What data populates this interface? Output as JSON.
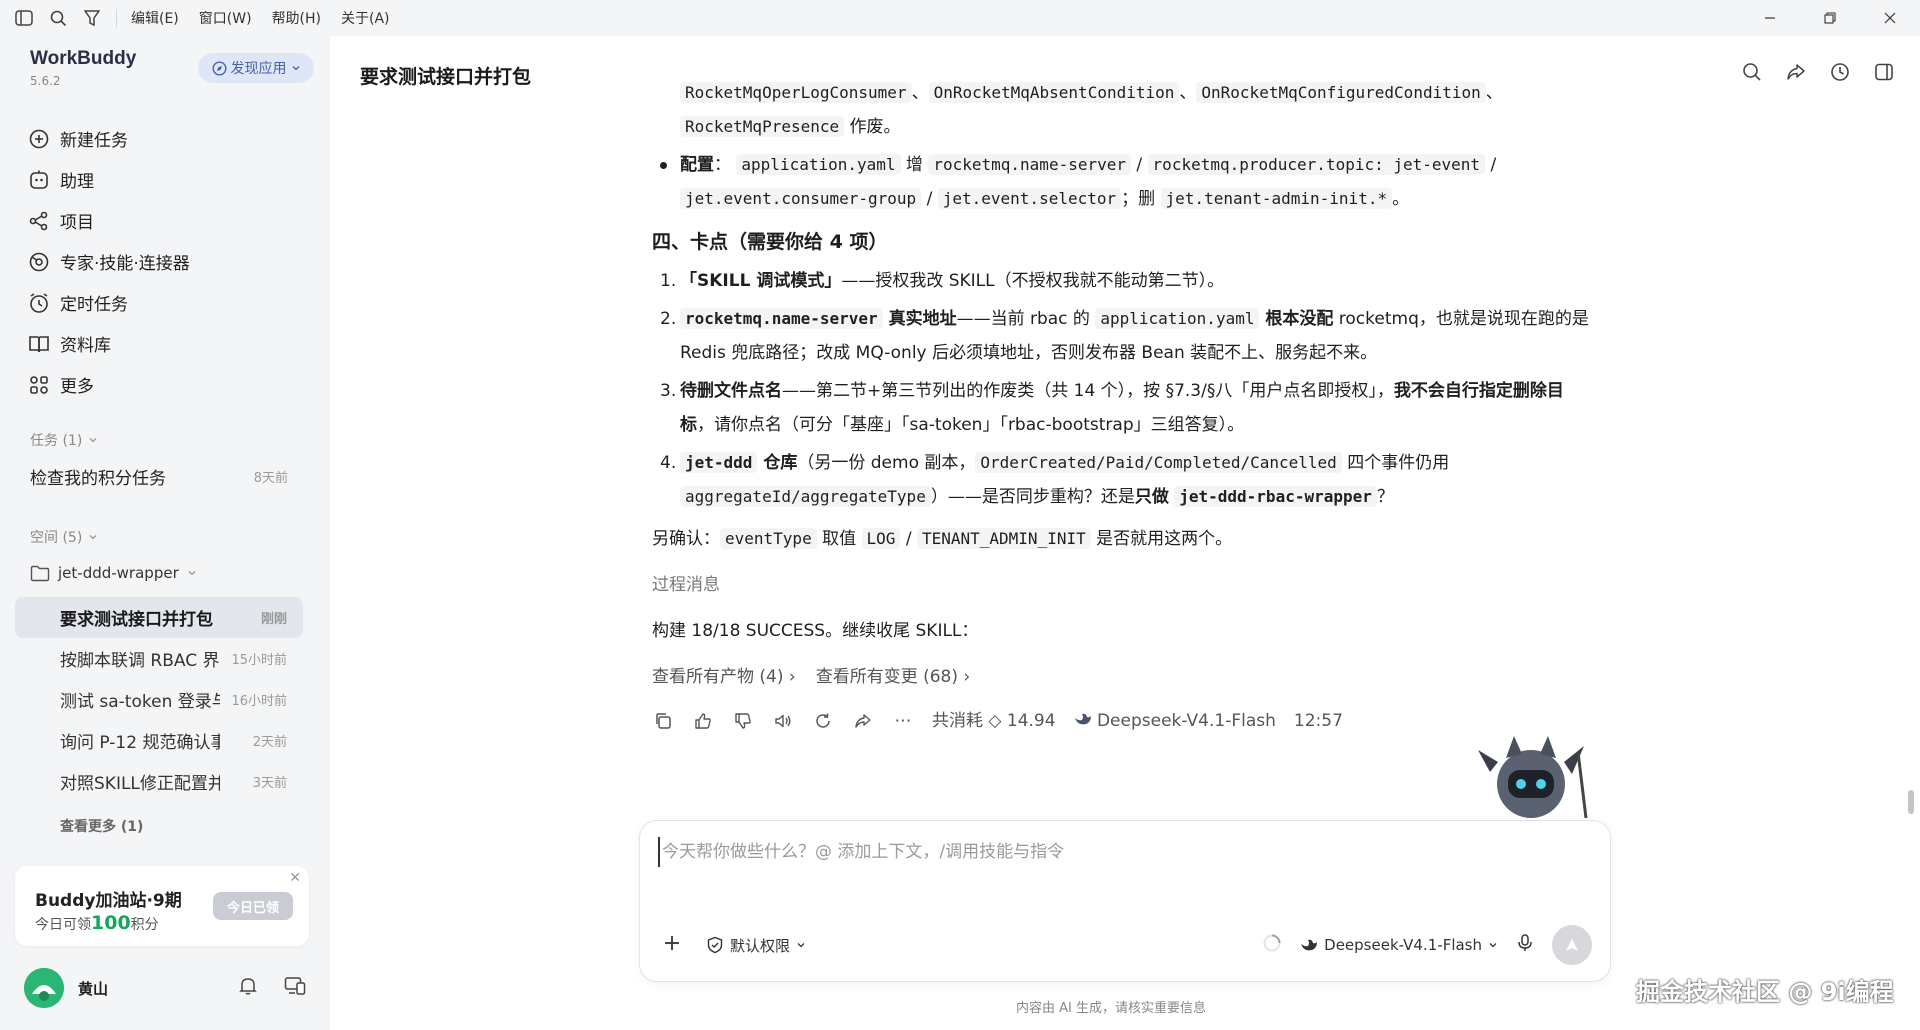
{
  "menubar": {
    "menus": [
      "编辑(E)",
      "窗口(W)",
      "帮助(H)",
      "关于(A)"
    ]
  },
  "app": {
    "name": "WorkBuddy",
    "version": "5.6.2",
    "discover_label": "发现应用"
  },
  "nav": [
    {
      "label": "新建任务",
      "icon": "plus-circle-icon"
    },
    {
      "label": "助理",
      "icon": "assistant-icon"
    },
    {
      "label": "项目",
      "icon": "project-icon"
    },
    {
      "label": "专家·技能·连接器",
      "icon": "expert-icon"
    },
    {
      "label": "定时任务",
      "icon": "clock-icon"
    },
    {
      "label": "资料库",
      "icon": "book-icon"
    },
    {
      "label": "更多",
      "icon": "grid-icon"
    }
  ],
  "tasks": {
    "header": "任务 (1)",
    "items": [
      {
        "title": "检查我的积分任务",
        "time": "8天前"
      }
    ]
  },
  "spaces": {
    "header": "空间 (5)",
    "folder": "jet-ddd-wrapper",
    "conversations": [
      {
        "title": "要求测试接口并打包",
        "time": "刚刚"
      },
      {
        "title": "按脚本联调 RBAC 界",
        "time": "15小时前"
      },
      {
        "title": "测试 sa-token 登录与",
        "time": "16小时前"
      },
      {
        "title": "询问 P-12 规范确认事项",
        "time": "2天前"
      },
      {
        "title": "对照SKILL修正配置并出",
        "time": "3天前"
      }
    ],
    "see_more": "查看更多 (1)"
  },
  "promo": {
    "title": "Buddy加油站·9期",
    "sub_prefix": "今日可领",
    "points": "100",
    "sub_suffix": "积分",
    "button": "今日已领"
  },
  "user": {
    "name": "黄山"
  },
  "main": {
    "title": "要求测试接口并打包",
    "top_line": {
      "codes": [
        "RocketMqOperLogConsumer",
        "OnRocketMqAbsentCondition",
        "OnRocketMqConfiguredCondition"
      ],
      "sep": "、"
    },
    "line2": {
      "code": "RocketMqPresence",
      "text": " 作废。"
    },
    "config": {
      "label": "配置",
      "colon": "：",
      "c1": "application.yaml",
      "t1": " 增 ",
      "c2": "rocketmq.name-server",
      "slash": " / ",
      "c3": "rocketmq.producer.topic: jet-event",
      "c4": "jet.event.consumer-group",
      "c5": "jet.event.selector",
      "t2": "；删 ",
      "c6": "jet.tenant-admin-init.*",
      "end": "。"
    },
    "section_title": "四、卡点（需要你给 4 项）",
    "items": [
      {
        "num": "1.",
        "bold": "「SKILL 调试模式」",
        "text": "——授权我改 SKILL（不授权我就不能动第二节）。"
      },
      {
        "num": "2.",
        "code": "rocketmq.name-server",
        "bold": " 真实地址",
        "text": "——当前 rbac 的 ",
        "code2": "application.yaml",
        "bold2": " 根本没配",
        "text2": " rocketmq，也就是说现在跑的是 Redis 兜底路径；改成 MQ-only 后必须填地址，否则发布器 Bean 装配不上、服务起不来。"
      },
      {
        "num": "3.",
        "bold": "待删文件点名",
        "text": "——第二节+第三节列出的作废类（共 14 个），按 §7.3/§八「用户点名即授权」，",
        "bold2": "我不会自行指定删除目标",
        "text2": "，请你点名（可分「基座」「sa-token」「rbac-bootstrap」三组答复）。"
      },
      {
        "num": "4.",
        "code": "jet-ddd",
        "bold": " 仓库",
        "text": "（另一份 demo 副本，",
        "code2": "OrderCreated/Paid/Completed/Cancelled",
        "text2": " 四个事件仍用 ",
        "code3": "aggregateId/aggregateType",
        "text3": "）——是否同步重构？还是",
        "bold2": "只做",
        "code4": "jet-ddd-rbac-wrapper",
        "text4": "？"
      }
    ],
    "confirm": {
      "pre": "另确认：",
      "c1": "eventType",
      "t1": " 取值 ",
      "c2": "LOG",
      "slash": " / ",
      "c3": "TENANT_ADMIN_INIT",
      "t2": " 是否就用这两个。"
    },
    "process_msg": "过程消息",
    "build_status": "构建 18/18 SUCCESS。继续收尾 SKILL：",
    "links": [
      "查看所有产物 (4)",
      "查看所有变更 (68)"
    ],
    "meta": {
      "cost_label": "共消耗",
      "cost": "14.94",
      "model": "Deepseek-V4.1-Flash",
      "time": "12:57"
    }
  },
  "composer": {
    "placeholder": "今天帮你做些什么？@ 添加上下文，/调用技能与指令",
    "permission": "默认权限",
    "model": "Deepseek-V4.1-Flash"
  },
  "footer_note": "内容由 AI 生成，请核实重要信息",
  "watermark": "掘金技术社区 @ 9i编程"
}
